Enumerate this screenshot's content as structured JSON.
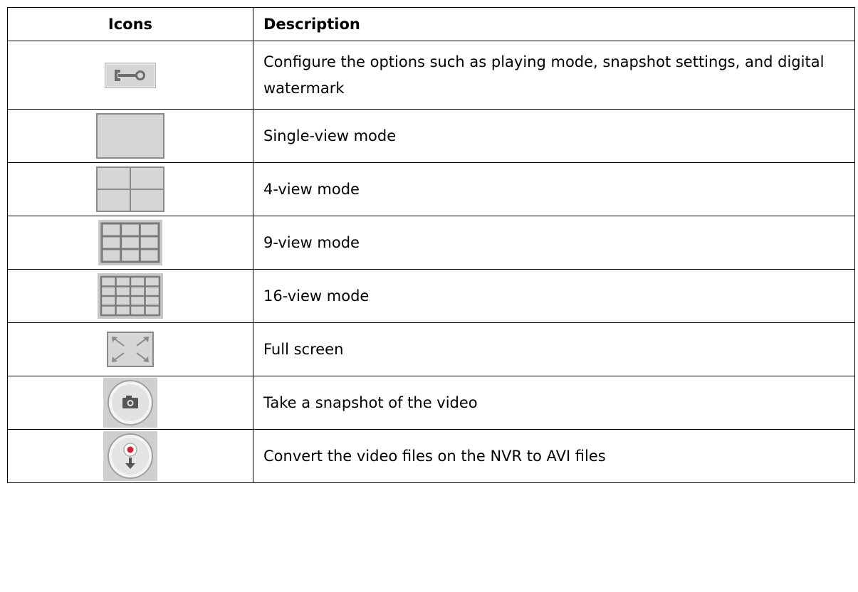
{
  "headers": {
    "icons": "Icons",
    "description": "Description"
  },
  "rows": [
    {
      "icon": "wrench-icon",
      "description": "Configure the options such as playing mode, snapshot settings, and digital watermark"
    },
    {
      "icon": "single-view-icon",
      "description": "Single-view mode"
    },
    {
      "icon": "four-view-icon",
      "description": "4-view mode"
    },
    {
      "icon": "nine-view-icon",
      "description": "9-view mode"
    },
    {
      "icon": "sixteen-view-icon",
      "description": "16-view mode"
    },
    {
      "icon": "fullscreen-icon",
      "description": "Full screen"
    },
    {
      "icon": "camera-icon",
      "description": "Take a snapshot of the video"
    },
    {
      "icon": "convert-avi-icon",
      "description": "Convert the video files on the NVR to AVI files"
    }
  ],
  "colors": {
    "icon_face": "#d6d6d6",
    "icon_border": "#8a8a8a",
    "record_red": "#d0282a"
  }
}
